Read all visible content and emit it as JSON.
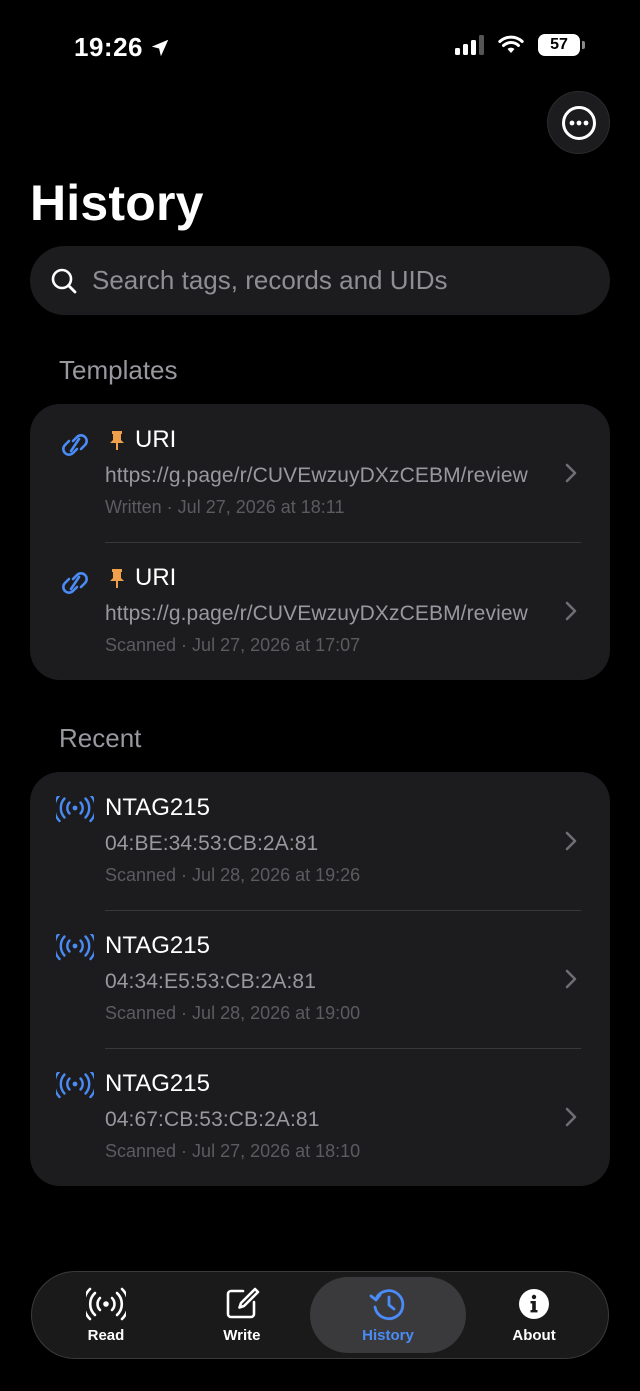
{
  "status_bar": {
    "time": "19:26",
    "battery": "57"
  },
  "header": {
    "title": "History",
    "more_icon": "ellipsis-circle-icon"
  },
  "search": {
    "placeholder": "Search tags, records and UIDs",
    "value": ""
  },
  "templates": {
    "header": "Templates",
    "items": [
      {
        "icon": "link-icon",
        "pinned": true,
        "title": "URI",
        "subtitle": "https://g.page/r/CUVEwzuyDXzCEBM/review",
        "meta": "Written · Jul 27, 2026 at 18:11"
      },
      {
        "icon": "link-icon",
        "pinned": true,
        "title": "URI",
        "subtitle": "https://g.page/r/CUVEwzuyDXzCEBM/review",
        "meta": "Scanned · Jul 27, 2026 at 17:07"
      }
    ]
  },
  "recent": {
    "header": "Recent",
    "items": [
      {
        "icon": "nfc-waves-icon",
        "title": "NTAG215",
        "subtitle": "04:BE:34:53:CB:2A:81",
        "meta": "Scanned · Jul 28, 2026 at 19:26"
      },
      {
        "icon": "nfc-waves-icon",
        "title": "NTAG215",
        "subtitle": "04:34:E5:53:CB:2A:81",
        "meta": "Scanned · Jul 28, 2026 at 19:00"
      },
      {
        "icon": "nfc-waves-icon",
        "title": "NTAG215",
        "subtitle": "04:67:CB:53:CB:2A:81",
        "meta": "Scanned · Jul 27, 2026 at 18:10"
      }
    ]
  },
  "tab_bar": {
    "tabs": [
      {
        "label": "Read",
        "icon": "nfc-waves-icon",
        "active": false
      },
      {
        "label": "Write",
        "icon": "square-pencil-icon",
        "active": false
      },
      {
        "label": "History",
        "icon": "clock-history-icon",
        "active": true
      },
      {
        "label": "About",
        "icon": "info-circle-icon",
        "active": false
      }
    ]
  },
  "colors": {
    "accent": "#4a8bf5",
    "pin": "#f0a04b",
    "background": "#000000",
    "card": "#1c1c1e"
  }
}
